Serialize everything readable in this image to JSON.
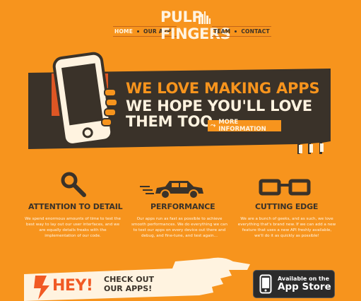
{
  "nav": {
    "left": [
      {
        "label": "HOME",
        "active": true
      },
      {
        "label": "OUR APPS",
        "active": false
      }
    ],
    "right": [
      {
        "label": "TEAM",
        "active": false
      },
      {
        "label": "CONTACT",
        "active": false
      }
    ]
  },
  "logo": {
    "line1": "PULP",
    "line2": "FINGERS"
  },
  "hero": {
    "line1": "WE LOVE MAKING APPS",
    "line2": "WE HOPE YOU'LL LOVE",
    "line3": "THEM TOO",
    "cta_label": "MORE INFORMATION",
    "cta_icon": "arrow-icon"
  },
  "features": [
    {
      "title": "ATTENTION TO DETAIL",
      "icon": "magnifier-icon",
      "body": "We spend enormous amounts of time to test the best way to lay out our user interfaces, and we are equally details freaks with the implementation of our code."
    },
    {
      "title": "PERFORMANCE",
      "icon": "car-icon",
      "body": "Our apps run as fast as possible to achieve smooth performances. We do everything we can to test our apps on every device out there and debug, and fine-tune, and test again..."
    },
    {
      "title": "CUTTING EDGE",
      "icon": "glasses-icon",
      "body": "We are a bunch of geeks, and as such, we love everything that's brand new. If we can add a new feature that uses a new API freshly available, we'll do it as quickly as possible!"
    }
  ],
  "bottom": {
    "hey": "HEY!",
    "check_line1": "CHECK OUT",
    "check_line2": "OUR APPS!",
    "appstore_small": "Available on the",
    "appstore_big": "App Store"
  },
  "colors": {
    "background": "#f7941d",
    "dark": "#3a3229",
    "cream": "#fff3e0",
    "red": "#f15a24"
  }
}
